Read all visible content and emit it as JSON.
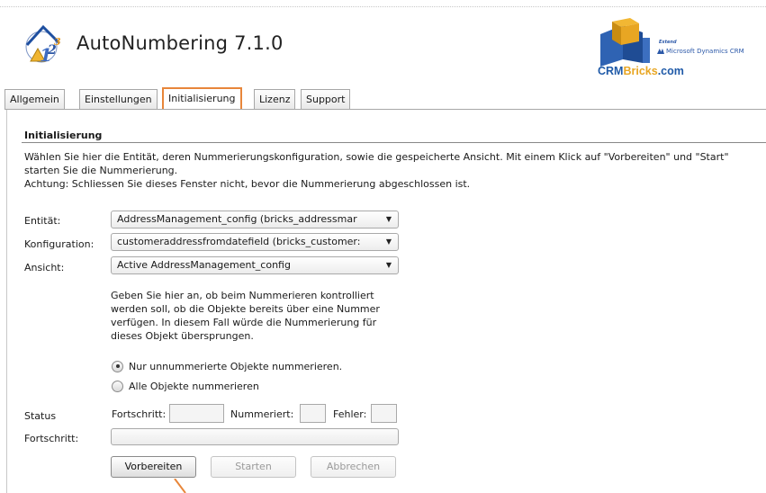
{
  "header": {
    "title": "AutoNumbering 7.1.0",
    "brand": {
      "extend": "Extend",
      "ms": "Microsoft Dynamics CRM",
      "url_crm": "CRM",
      "url_bricks": "Bricks",
      "url_com": ".com"
    }
  },
  "tabs": [
    {
      "label": "Allgemein",
      "active": false
    },
    {
      "label": "Einstellungen",
      "active": false
    },
    {
      "label": "Initialisierung",
      "active": true
    },
    {
      "label": "Lizenz",
      "active": false
    },
    {
      "label": "Support",
      "active": false
    }
  ],
  "section": {
    "title": "Initialisierung",
    "description_1": "Wählen Sie hier die Entität, deren Nummerierungskonfiguration, sowie die gespeicherte Ansicht. Mit einem Klick auf \"Vorbereiten\" und \"Start\" starten Sie die Nummerierung.",
    "description_2": "Achtung: Schliessen Sie dieses Fenster nicht, bevor die Nummerierung abgeschlossen ist."
  },
  "form": {
    "entity": {
      "label": "Entität:",
      "value": "AddressManagement_config (bricks_addressmar"
    },
    "config": {
      "label": "Konfiguration:",
      "value": "customeraddressfromdatefield (bricks_customer:"
    },
    "view": {
      "label": "Ansicht:",
      "value": "Active AddressManagement_config"
    },
    "hint": "Geben Sie hier an, ob beim Nummerieren kontrolliert werden soll, ob die Objekte bereits über eine Nummer verfügen. In diesem Fall würde die Nummerierung für dieses Objekt übersprungen.",
    "radios": [
      {
        "label": "Nur unnummerierte Objekte nummerieren.",
        "checked": true
      },
      {
        "label": "Alle Objekte nummerieren",
        "checked": false
      }
    ]
  },
  "status": {
    "label": "Status",
    "progress_label": "Fortschritt:",
    "numbered_label": "Nummeriert:",
    "errors_label": "Fehler:",
    "progress_row_label": "Fortschritt:"
  },
  "buttons": {
    "prepare": "Vorbereiten",
    "start": "Starten",
    "cancel": "Abbrechen"
  },
  "colors": {
    "active_tab_border": "#e8863a",
    "brand_blue": "#1f5aa8",
    "brand_orange": "#e8a623"
  }
}
